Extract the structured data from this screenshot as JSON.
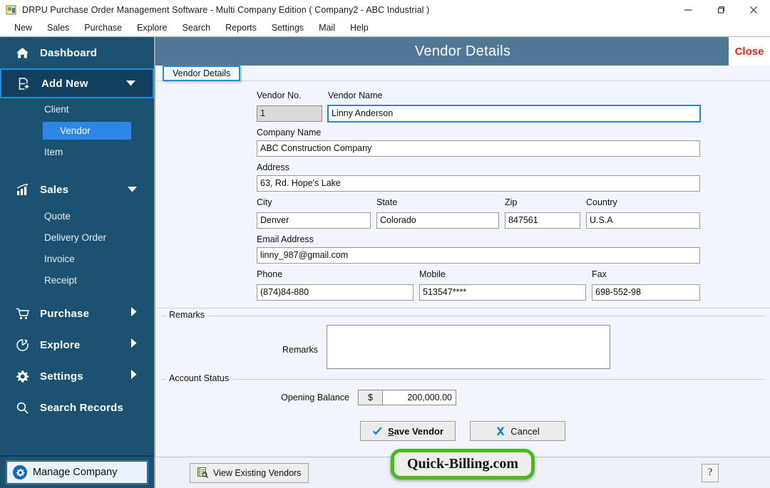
{
  "window": {
    "title": "DRPU Purchase Order Management Software - Multi Company Edition ( Company2 - ABC Industrial )",
    "minimize": "–",
    "maximize": "❐",
    "close": "✕"
  },
  "menu": {
    "items": [
      {
        "label": "New"
      },
      {
        "label": "Sales"
      },
      {
        "label": "Purchase"
      },
      {
        "label": "Explore"
      },
      {
        "label": "Search"
      },
      {
        "label": "Reports"
      },
      {
        "label": "Settings"
      },
      {
        "label": "Mail"
      },
      {
        "label": "Help"
      }
    ]
  },
  "sidebar": {
    "dashboard": "Dashboard",
    "add_new": "Add New",
    "add_new_children": [
      {
        "label": "Client",
        "active": false
      },
      {
        "label": "Vendor",
        "active": true
      },
      {
        "label": "Item",
        "active": false
      }
    ],
    "sales": "Sales",
    "sales_children": [
      {
        "label": "Quote"
      },
      {
        "label": "Delivery Order"
      },
      {
        "label": "Invoice"
      },
      {
        "label": "Receipt"
      }
    ],
    "purchase": "Purchase",
    "explore": "Explore",
    "settings": "Settings",
    "search_records": "Search Records",
    "manage_company": "Manage Company"
  },
  "panel": {
    "title": "Vendor Details",
    "close_label": "Close",
    "tab_label": "Vendor Details"
  },
  "form": {
    "vendor_no_label": "Vendor No.",
    "vendor_no_value": "1",
    "vendor_name_label": "Vendor Name",
    "vendor_name_value": "Linny Anderson",
    "company_name_label": "Company Name",
    "company_name_value": "ABC Construction Company",
    "address_label": "Address",
    "address_value": "63, Rd. Hope's Lake",
    "city_label": "City",
    "city_value": "Denver",
    "state_label": "State",
    "state_value": "Colorado",
    "zip_label": "Zip",
    "zip_value": "847561",
    "country_label": "Country",
    "country_value": "U.S.A",
    "email_label": "Email Address",
    "email_value": "linny_987@gmail.com",
    "phone_label": "Phone",
    "phone_value": "(874)84-880",
    "mobile_label": "Mobile",
    "mobile_value": "513547****",
    "fax_label": "Fax",
    "fax_value": "698-552-98"
  },
  "remarks": {
    "group_label": "Remarks",
    "field_label": "Remarks",
    "value": "",
    "scroll_up": "∧",
    "scroll_down": "∨"
  },
  "account_status": {
    "group_label": "Account Status",
    "opening_balance_label": "Opening Balance",
    "currency_symbol": "$",
    "opening_balance_value": "200,000.00"
  },
  "buttons": {
    "save_prefix": "S",
    "save_rest": "ave Vendor",
    "cancel": "Cancel",
    "view_existing": "View Existing Vendors",
    "help": "?"
  },
  "footer": {
    "brand": "Quick-Billing.com"
  },
  "colors": {
    "sidebar_bg": "#1b5272",
    "sidebar_selected": "#133f5c",
    "accent_blue": "#2e86e8",
    "header_bar": "#4f7996",
    "close_red": "#e8201a",
    "brand_green": "#4db81b",
    "content_bg": "#f2f5fd"
  }
}
